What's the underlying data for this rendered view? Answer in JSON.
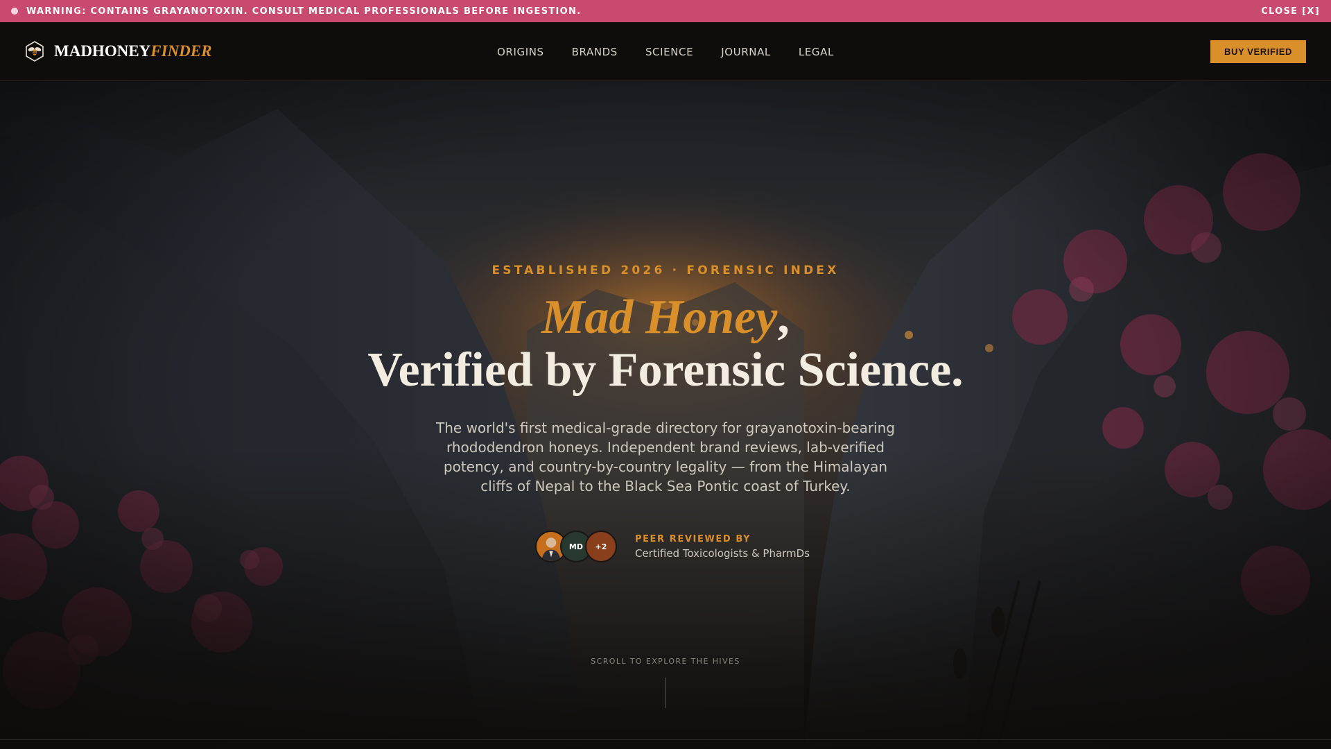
{
  "warning": {
    "text": "WARNING: CONTAINS GRAYANOTOXIN. CONSULT MEDICAL PROFESSIONALS BEFORE INGESTION.",
    "close_label": "CLOSE [X]"
  },
  "brand": {
    "name_main": "MADHONEY",
    "name_accent": "FINDER"
  },
  "nav": {
    "items": [
      {
        "label": "ORIGINS"
      },
      {
        "label": "BRANDS"
      },
      {
        "label": "SCIENCE"
      },
      {
        "label": "JOURNAL"
      },
      {
        "label": "LEGAL"
      }
    ],
    "cta_label": "BUY VERIFIED"
  },
  "hero": {
    "eyebrow": "ESTABLISHED 2026 · FORENSIC INDEX",
    "headline_accent": "Mad Honey",
    "headline_comma": ",",
    "headline_line2": "Verified by Forensic Science.",
    "subcopy": "The world's first medical-grade directory for grayanotoxin-bearing rhododendron honeys. Independent brand reviews, lab-verified potency, and country-by-country legality — from the Himalayan cliffs of Nepal to the Black Sea Pontic coast of Turkey.",
    "reviewers": {
      "avatar_md": "MD",
      "avatar_more": "+2",
      "label": "PEER REVIEWED BY",
      "description": "Certified Toxicologists & PharmDs"
    },
    "scroll_hint": "SCROLL TO EXPLORE THE HIVES"
  },
  "colors": {
    "warning_bg": "#c84a6e",
    "accent": "#d9902a",
    "nav_bg": "#0f0d0b"
  }
}
